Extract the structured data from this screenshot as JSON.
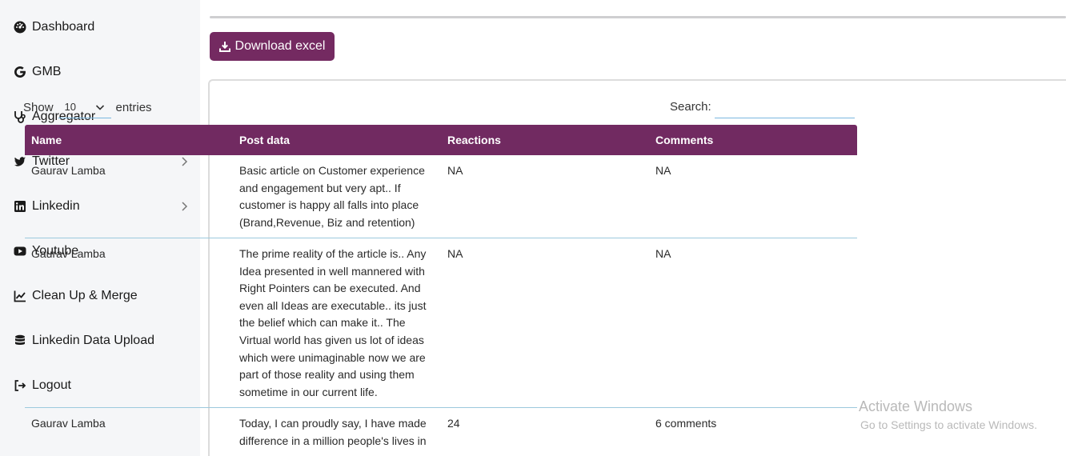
{
  "sidebar": {
    "items": [
      {
        "label": "Dashboard",
        "icon": "tachometer-icon"
      },
      {
        "label": "GMB",
        "icon": "google-icon"
      },
      {
        "label": "Aggregator",
        "icon": "stethoscope-icon"
      },
      {
        "label": "Twitter",
        "icon": "twitter-icon",
        "has_submenu": true
      },
      {
        "label": "Linkedin",
        "icon": "linkedin-icon",
        "has_submenu": true
      },
      {
        "label": "Youtube",
        "icon": "youtube-icon"
      },
      {
        "label": "Clean Up & Merge",
        "icon": "line-chart-icon"
      },
      {
        "label": "Linkedin Data Upload",
        "icon": "database-icon"
      },
      {
        "label": "Logout",
        "icon": "sign-out-icon"
      }
    ]
  },
  "toolbar": {
    "download_label": "Download excel"
  },
  "table_controls": {
    "show_label": "Show",
    "entries_value": "10",
    "entries_label": "entries",
    "search_label": "Search:",
    "search_value": ""
  },
  "table": {
    "columns": [
      "Name",
      "Post data",
      "Reactions",
      "Comments"
    ],
    "rows": [
      {
        "name": "Gaurav Lamba",
        "post": "Basic article on Customer experience and engagement but very apt.. If customer is happy all falls into place (Brand,Revenue, Biz and retention)",
        "reactions": "NA",
        "comments": "NA"
      },
      {
        "name": "Gaurav Lamba",
        "post": "The prime reality of the article is.. Any Idea presented in well mannered with Right Pointers can be executed. And even all Ideas are executable.. its just the belief which can make it.. The Virtual world has given us lot of ideas which were unimaginable now we are part of those reality and using them sometime in our current life.",
        "reactions": "NA",
        "comments": "NA"
      },
      {
        "name": "Gaurav Lamba",
        "post": "Today, I can proudly say, I have made difference in a million people's lives in",
        "reactions": "24",
        "comments": "6 comments"
      }
    ]
  },
  "watermark": {
    "title": "Activate Windows",
    "subtitle": "Go to Settings to activate Windows."
  },
  "colors": {
    "brand": "#742a61",
    "row_divider": "#9cc9dd",
    "input_underline": "#7ab8df"
  }
}
